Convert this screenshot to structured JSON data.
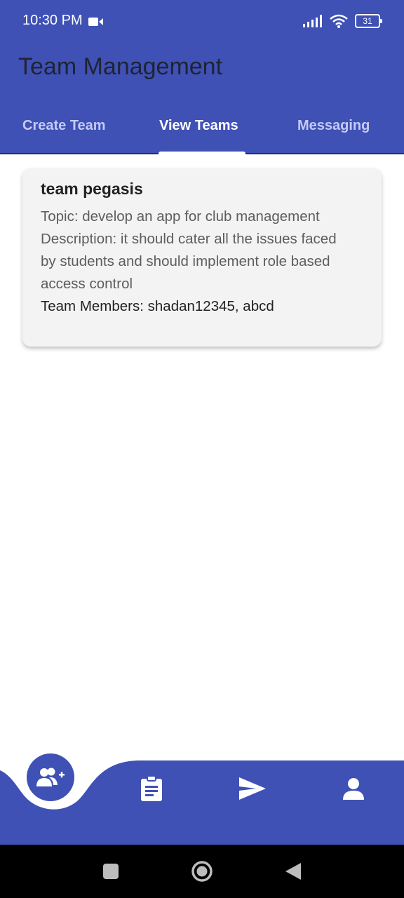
{
  "status_bar": {
    "time": "10:30 PM",
    "battery": "31"
  },
  "app_bar": {
    "title": "Team Management"
  },
  "tabs": [
    {
      "label": "Create Team"
    },
    {
      "label": "View Teams",
      "active": true
    },
    {
      "label": "Messaging"
    }
  ],
  "team_card": {
    "name": "team pegasis",
    "topic": "Topic: develop an app for club management",
    "description": "Description: it should cater all the issues faced by students and should implement role based access control",
    "members": "Team Members: shadan12345, abcd"
  },
  "bottom_nav": {
    "items": [
      {
        "icon": "add-group-icon",
        "active": true
      },
      {
        "icon": "clipboard-icon"
      },
      {
        "icon": "send-icon"
      },
      {
        "icon": "person-icon"
      }
    ]
  },
  "colors": {
    "primary": "#3f51b5",
    "card": "#f3f3f3"
  }
}
